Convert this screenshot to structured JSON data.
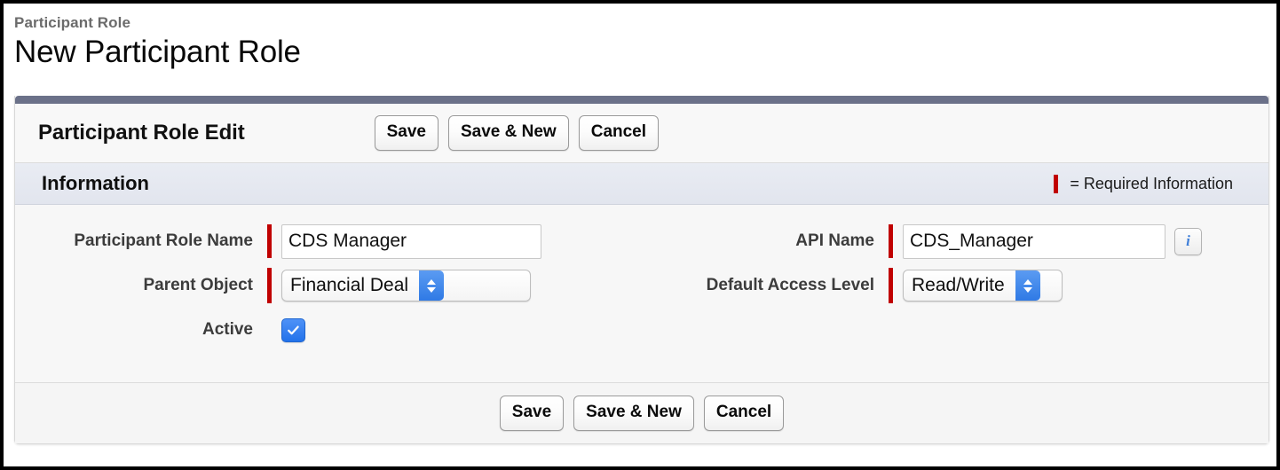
{
  "header": {
    "eyebrow": "Participant Role",
    "title": "New Participant Role"
  },
  "panel": {
    "accent_color": "#6b7189",
    "toolbar": {
      "title": "Participant Role Edit",
      "buttons": {
        "save": "Save",
        "save_new": "Save & New",
        "cancel": "Cancel"
      }
    },
    "section": {
      "title": "Information",
      "required_legend": "= Required Information",
      "required_color": "#c00000"
    },
    "fields": {
      "participant_role_name": {
        "label": "Participant Role Name",
        "value": "CDS Manager",
        "placeholder": "",
        "required": true
      },
      "api_name": {
        "label": "API Name",
        "value": "CDS_Manager",
        "placeholder": "",
        "required": true,
        "info_icon": "info-icon"
      },
      "parent_object": {
        "label": "Parent Object",
        "value": "Financial Deal",
        "required": true
      },
      "default_access_level": {
        "label": "Default Access Level",
        "value": "Read/Write",
        "required": true
      },
      "active": {
        "label": "Active",
        "checked": true
      }
    },
    "footer": {
      "buttons": {
        "save": "Save",
        "save_new": "Save & New",
        "cancel": "Cancel"
      }
    }
  }
}
